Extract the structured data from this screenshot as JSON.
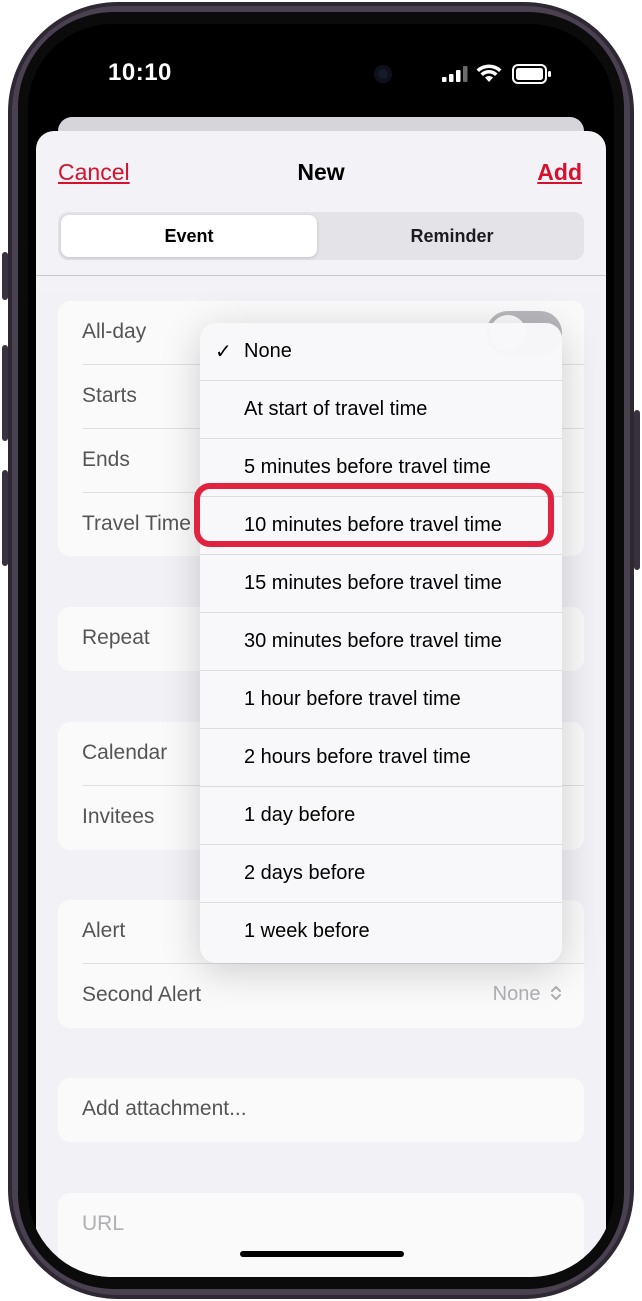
{
  "status_bar": {
    "time": "10:10"
  },
  "nav": {
    "cancel": "Cancel",
    "title": "New",
    "add": "Add"
  },
  "segments": {
    "event": "Event",
    "reminder": "Reminder"
  },
  "rows": {
    "all_day": "All-day",
    "starts": "Starts",
    "ends": "Ends",
    "travel_time": "Travel Time",
    "repeat": "Repeat",
    "calendar": "Calendar",
    "invitees": "Invitees",
    "alert": "Alert",
    "second_alert": "Second Alert",
    "second_alert_value": "None",
    "add_attachment": "Add attachment...",
    "url": "URL"
  },
  "menu": {
    "checkmark": "✓",
    "items": [
      "None",
      "At start of travel time",
      "5 minutes before travel time",
      "10 minutes before travel time",
      "15 minutes before travel time",
      "30 minutes before travel time",
      "1 hour before travel time",
      "2 hours before travel time",
      "1 day before",
      "2 days before",
      "1 week before"
    ],
    "selected": "None",
    "highlighted": "30 minutes before travel time"
  },
  "colors": {
    "accent": "#d6112e",
    "highlight_outline": "#e0243f"
  },
  "icons": {
    "cellular": "cellular-signal-icon",
    "wifi": "wifi-icon",
    "battery": "battery-icon",
    "stepper": "chevron-up-down-icon"
  }
}
